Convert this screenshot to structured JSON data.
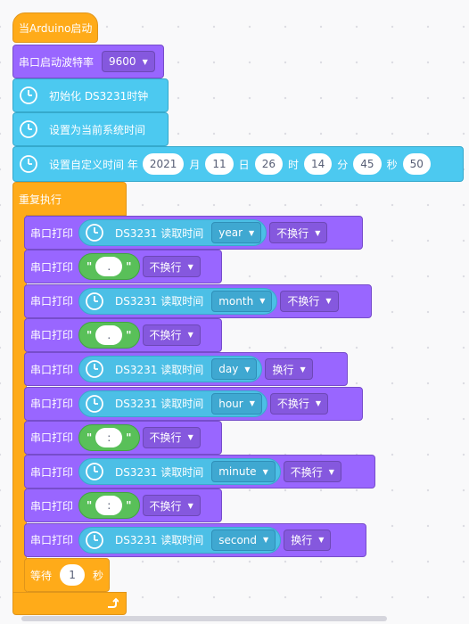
{
  "hat": {
    "label": "当Arduino启动"
  },
  "serial_begin": {
    "label": "串口启动波特率",
    "baud": "9600"
  },
  "init_rtc": {
    "label": "初始化 DS3231时钟"
  },
  "set_now": {
    "label": "设置为当前系统时间"
  },
  "set_custom": {
    "label": "设置自定义时间 年",
    "year": "2021",
    "month_label": "月",
    "month": "11",
    "day_label": "日",
    "day": "26",
    "hour_label": "时",
    "hour": "14",
    "minute_label": "分",
    "minute": "45",
    "second_label": "秒",
    "second": "50"
  },
  "forever": {
    "label": "重复执行"
  },
  "print_label": "串口打印",
  "read_label": "DS3231 读取时间",
  "prints": [
    {
      "kind": "rtc",
      "field": "year",
      "newline": "不换行"
    },
    {
      "kind": "str",
      "text": ".",
      "newline": "不换行"
    },
    {
      "kind": "rtc",
      "field": "month",
      "newline": "不换行"
    },
    {
      "kind": "str",
      "text": ".",
      "newline": "不换行"
    },
    {
      "kind": "rtc",
      "field": "day",
      "newline": "换行"
    },
    {
      "kind": "rtc",
      "field": "hour",
      "newline": "不换行"
    },
    {
      "kind": "str",
      "text": ":",
      "newline": "不换行"
    },
    {
      "kind": "rtc",
      "field": "minute",
      "newline": "不换行"
    },
    {
      "kind": "str",
      "text": ":",
      "newline": "不换行"
    },
    {
      "kind": "rtc",
      "field": "second",
      "newline": "换行"
    }
  ],
  "wait": {
    "label": "等待",
    "value": "1",
    "unit": "秒"
  },
  "quote_mark": "\"",
  "icons": {
    "clock": "clock-icon",
    "dropdown": "caret-down-icon",
    "loop": "loop-arrow-icon"
  },
  "colors": {
    "control": "#ffab19",
    "serial": "#9966ff",
    "rtc": "#4cc9f0",
    "string": "#59c059"
  }
}
